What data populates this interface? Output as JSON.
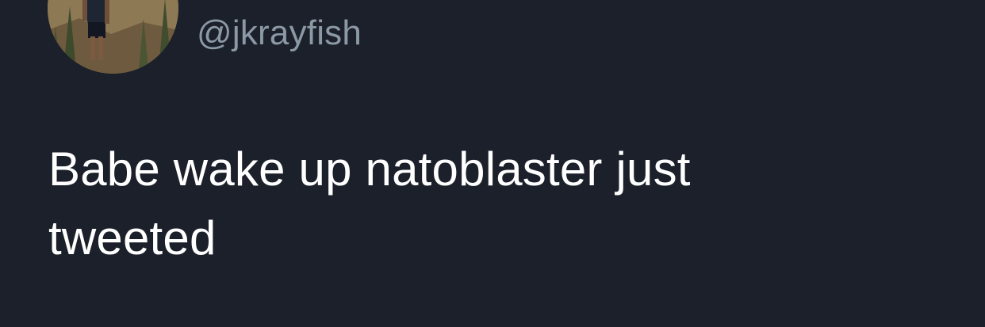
{
  "author": {
    "handle": "@jkrayfish",
    "avatar_icon": "profile-photo-hiker"
  },
  "tweet": {
    "text": "Babe wake up natoblaster just tweeted"
  },
  "colors": {
    "background": "#1b202a",
    "text": "#ffffff",
    "handle": "#8b98a5"
  }
}
